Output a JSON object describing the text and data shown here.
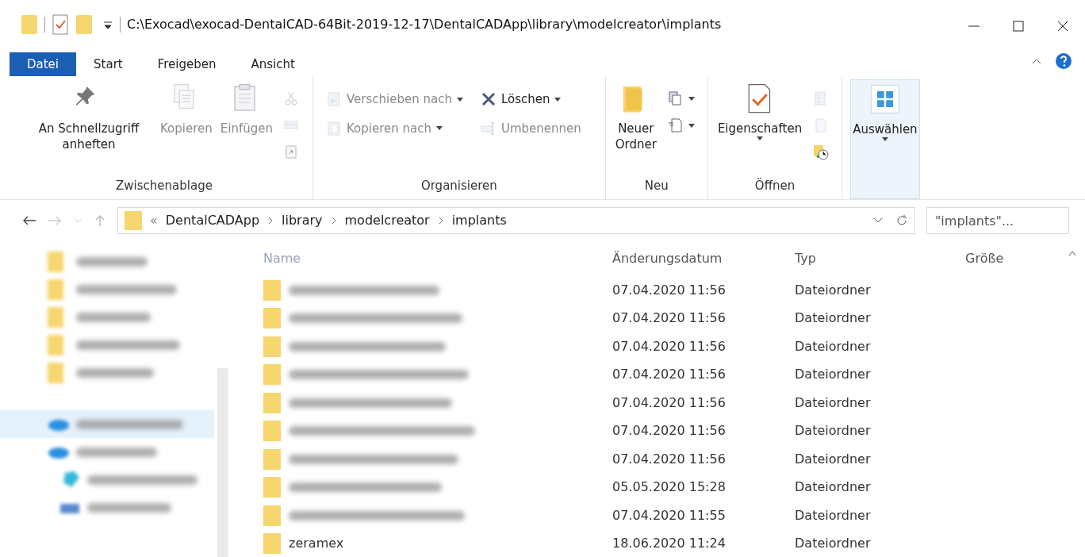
{
  "window": {
    "title": "C:\\Exocad\\exocad-DentalCAD-64Bit-2019-12-17\\DentalCADApp\\library\\modelcreator\\implants"
  },
  "ribbon_tabs": [
    {
      "label": "Datei",
      "kind": "file"
    },
    {
      "label": "Start",
      "kind": "tab"
    },
    {
      "label": "Freigeben",
      "kind": "tab"
    },
    {
      "label": "Ansicht",
      "kind": "tab"
    }
  ],
  "ribbon_groups": [
    {
      "label": "Zwischenablage",
      "big": [
        {
          "label": "An Schnellzugriff anheften",
          "disabled": false
        },
        {
          "label": "Kopieren",
          "disabled": true
        },
        {
          "label": "Einfügen",
          "disabled": true
        }
      ],
      "small": [
        {
          "disabled": true
        },
        {
          "disabled": true
        },
        {
          "disabled": true
        }
      ]
    },
    {
      "label": "Organisieren",
      "small": [
        {
          "label": "Verschieben nach",
          "disabled": true,
          "dropdown": true
        },
        {
          "label": "Löschen",
          "disabled": false,
          "dropdown": true
        },
        {
          "label": "Kopieren nach",
          "disabled": true,
          "dropdown": true
        },
        {
          "label": "Umbenennen",
          "disabled": true,
          "dropdown": false
        }
      ]
    },
    {
      "label": "Neu",
      "big": [
        {
          "label": "Neuer Ordner",
          "disabled": false
        }
      ],
      "small": [
        {
          "disabled": false,
          "dropdown": true
        },
        {
          "disabled": false,
          "dropdown": true
        }
      ]
    },
    {
      "label": "Öffnen",
      "big": [
        {
          "label": "Eigenschaften",
          "disabled": false,
          "dropdown": true
        }
      ],
      "small": [
        {
          "disabled": true
        },
        {
          "disabled": true
        },
        {
          "disabled": false
        }
      ]
    },
    {
      "big": [
        {
          "label": "Auswählen",
          "disabled": false,
          "dropdown": true,
          "selected": true
        }
      ]
    }
  ],
  "address_bar": {
    "overflow": "«",
    "crumbs": [
      "DentalCADApp",
      "library",
      "modelcreator",
      "implants"
    ]
  },
  "search": {
    "placeholder": "\"implants\"..."
  },
  "sidebar": {
    "items": [
      {
        "kind": "folder",
        "selected": false
      },
      {
        "kind": "folder",
        "selected": false
      },
      {
        "kind": "folder",
        "selected": false
      },
      {
        "kind": "folder",
        "selected": false
      },
      {
        "kind": "folder",
        "selected": false
      },
      {
        "kind": "cloud",
        "selected": true
      },
      {
        "kind": "cloud",
        "selected": false
      },
      {
        "kind": "cube",
        "selected": false
      },
      {
        "kind": "desktop",
        "selected": false
      }
    ]
  },
  "table": {
    "columns": [
      "Name",
      "Änderungsdatum",
      "Typ",
      "Größe"
    ],
    "rows": [
      {
        "date": "07.04.2020 11:56",
        "type": "Dateiordner"
      },
      {
        "date": "07.04.2020 11:56",
        "type": "Dateiordner"
      },
      {
        "date": "07.04.2020 11:56",
        "type": "Dateiordner"
      },
      {
        "date": "07.04.2020 11:56",
        "type": "Dateiordner"
      },
      {
        "date": "07.04.2020 11:56",
        "type": "Dateiordner"
      },
      {
        "date": "07.04.2020 11:56",
        "type": "Dateiordner"
      },
      {
        "date": "07.04.2020 11:56",
        "type": "Dateiordner"
      },
      {
        "date": "05.05.2020 15:28",
        "type": "Dateiordner"
      },
      {
        "date": "07.04.2020 11:55",
        "type": "Dateiordner"
      },
      {
        "name": "zeramex",
        "date": "18.06.2020 11:24",
        "type": "Dateiordner"
      }
    ]
  }
}
